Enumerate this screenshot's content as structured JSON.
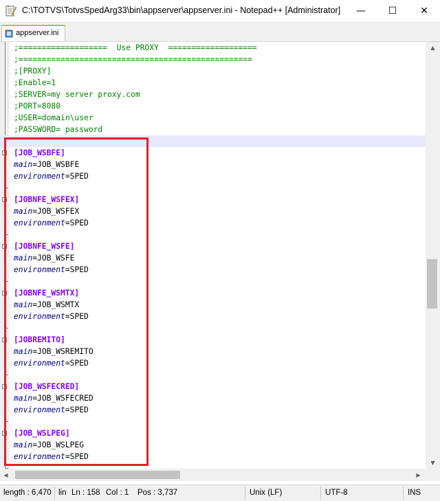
{
  "window": {
    "title": "C:\\TOTVS\\TotvsSpedArg33\\bin\\appserver\\appserver.ini - Notepad++ [Administrator]",
    "controls": {
      "minimize": "—",
      "maximize": "☐",
      "close": "✕"
    }
  },
  "tabs": [
    {
      "label": "appserver.ini",
      "icon": "ini-file-icon"
    }
  ],
  "editor": {
    "lines": [
      {
        "kind": "comment",
        "text": ";===================  Use PROXY  ==================="
      },
      {
        "kind": "comment",
        "text": ";=================================================="
      },
      {
        "kind": "comment",
        "text": ";[PROXY]"
      },
      {
        "kind": "comment",
        "text": ";Enable=1"
      },
      {
        "kind": "comment",
        "text": ";SERVER=my server proxy.com"
      },
      {
        "kind": "comment",
        "text": ";PORT=8080"
      },
      {
        "kind": "comment",
        "text": ";USER=domain\\user"
      },
      {
        "kind": "comment",
        "text": ";PASSWORD= password"
      },
      {
        "kind": "caret",
        "text": ""
      },
      {
        "kind": "section",
        "text": "[JOB_WSBFE]"
      },
      {
        "kind": "kv",
        "key": "main",
        "value": "JOB_WSBFE"
      },
      {
        "kind": "kv",
        "key": "environment",
        "value": "SPED"
      },
      {
        "kind": "blank",
        "text": ""
      },
      {
        "kind": "section",
        "text": "[JOBNFE_WSFEX]"
      },
      {
        "kind": "kv",
        "key": "main",
        "value": "JOB_WSFEX"
      },
      {
        "kind": "kv",
        "key": "environment",
        "value": "SPED"
      },
      {
        "kind": "blank",
        "text": ""
      },
      {
        "kind": "section",
        "text": "[JOBNFE_WSFE]"
      },
      {
        "kind": "kv",
        "key": "main",
        "value": "JOB_WSFE"
      },
      {
        "kind": "kv",
        "key": "environment",
        "value": "SPED"
      },
      {
        "kind": "blank",
        "text": ""
      },
      {
        "kind": "section",
        "text": "[JOBNFE_WSMTX]"
      },
      {
        "kind": "kv",
        "key": "main",
        "value": "JOB_WSMTX"
      },
      {
        "kind": "kv",
        "key": "environment",
        "value": "SPED"
      },
      {
        "kind": "blank",
        "text": ""
      },
      {
        "kind": "section",
        "text": "[JOBREMITO]"
      },
      {
        "kind": "kv",
        "key": "main",
        "value": "JOB_WSREMITO"
      },
      {
        "kind": "kv",
        "key": "environment",
        "value": "SPED"
      },
      {
        "kind": "blank",
        "text": ""
      },
      {
        "kind": "section",
        "text": "[JOB_WSFECRED]"
      },
      {
        "kind": "kv",
        "key": "main",
        "value": "JOB_WSFECRED"
      },
      {
        "kind": "kv",
        "key": "environment",
        "value": "SPED"
      },
      {
        "kind": "blank",
        "text": ""
      },
      {
        "kind": "section",
        "text": "[JOB_WSLPEG]"
      },
      {
        "kind": "kv",
        "key": "main",
        "value": "JOB_WSLPEG"
      },
      {
        "kind": "kv",
        "key": "environment",
        "value": "SPED"
      },
      {
        "kind": "blank",
        "text": ""
      }
    ]
  },
  "statusbar": {
    "length": "length : 6,470",
    "lines": "lin",
    "ln": "Ln : 158",
    "col": "Col : 1",
    "pos": "Pos : 3,737",
    "eol": "Unix (LF)",
    "encoding": "UTF-8",
    "mode": "INS"
  },
  "colors": {
    "comment": "#008000",
    "section": "#8000ff",
    "key": "#000080",
    "highlight": "#e0222c",
    "tab_accent": "#f9a83b"
  }
}
